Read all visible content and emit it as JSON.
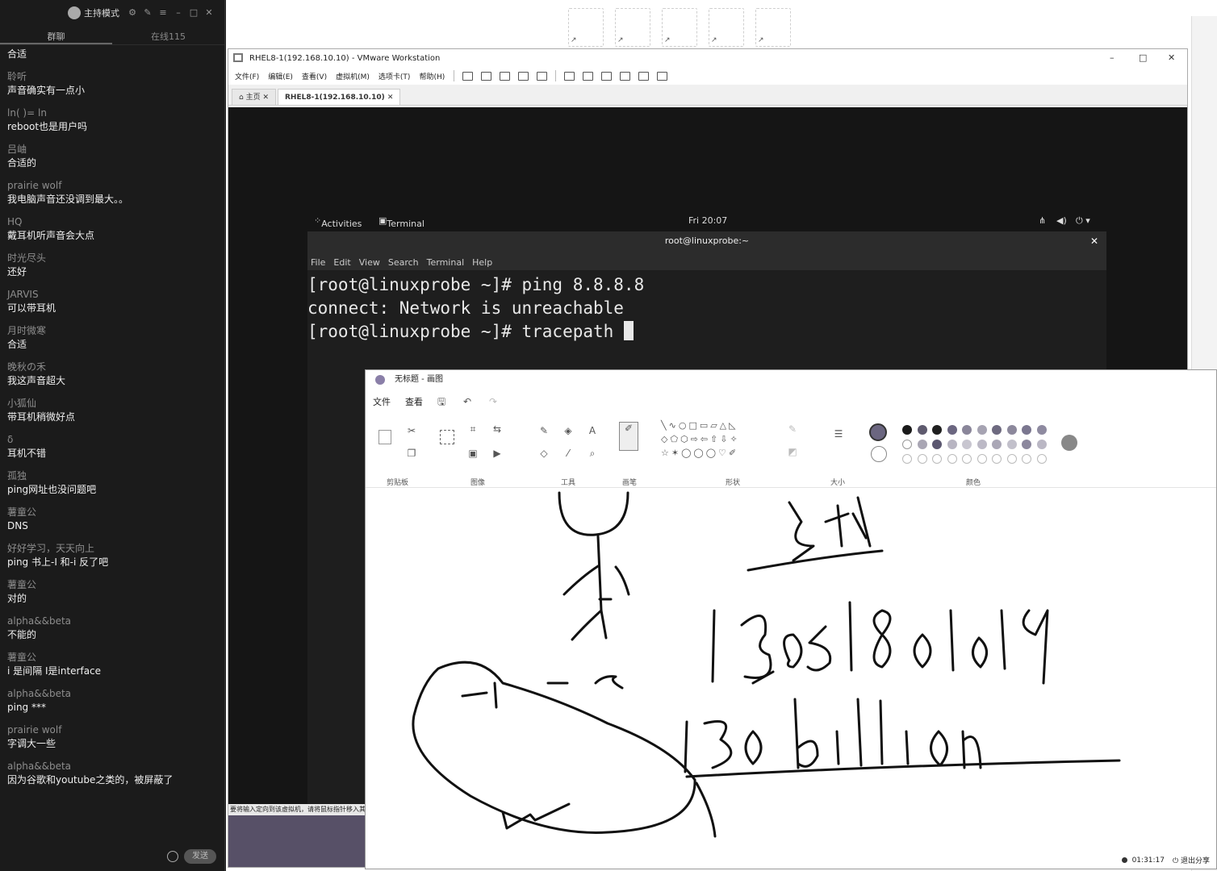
{
  "chat": {
    "mode_label": "主持模式",
    "tabs": [
      "群聊",
      "在线115"
    ],
    "messages": [
      {
        "user": "",
        "text": "合适"
      },
      {
        "user": "聆听",
        "text": "声音确实有一点小"
      },
      {
        "user": "ln(    )=     ln",
        "text": "reboot也是用户吗"
      },
      {
        "user": "吕岫",
        "text": "合适的"
      },
      {
        "user": "prairie wolf",
        "text": "我电脑声音还没调到最大。。"
      },
      {
        "user": "HQ",
        "text": "戴耳机听声音会大点"
      },
      {
        "user": "时光尽头",
        "text": "还好"
      },
      {
        "user": "JARVIS",
        "text": "可以带耳机"
      },
      {
        "user": "月时微寒",
        "text": "合适"
      },
      {
        "user": "晚秋の禾",
        "text": "我这声音超大"
      },
      {
        "user": "小狐仙",
        "text": "带耳机稍微好点"
      },
      {
        "user": "δ",
        "text": "耳机不错"
      },
      {
        "user": "孤独",
        "text": "ping网址也没问题吧"
      },
      {
        "user": "薯童公",
        "text": "DNS"
      },
      {
        "user": "好好学习，天天向上",
        "text": "ping 书上-I  和-i 反了吧"
      },
      {
        "user": "薯童公",
        "text": "对的"
      },
      {
        "user": "alpha&&beta",
        "text": "不能的"
      },
      {
        "user": "薯童公",
        "text": "i 是间隔 I是interface"
      },
      {
        "user": "alpha&&beta",
        "text": "ping  ***"
      },
      {
        "user": "prairie wolf",
        "text": "字调大一些"
      },
      {
        "user": "alpha&&beta",
        "text": "因为谷歌和youtube之类的，被屏蔽了"
      }
    ],
    "send_label": "发送"
  },
  "vmware": {
    "title": "RHEL8-1(192.168.10.10) - VMware Workstation",
    "menu": [
      "文件(F)",
      "编辑(E)",
      "查看(V)",
      "虚拟机(M)",
      "选项卡(T)",
      "帮助(H)"
    ],
    "tabs": [
      "主页",
      "RHEL8-1(192.168.10.10)"
    ],
    "status_text": "要将输入定向到该虚拟机，请将鼠标指针移入其中或按 Ctrl+G。"
  },
  "gnome": {
    "activities": "Activities",
    "app_menu": "Terminal ▾",
    "clock": "Fri 20:07"
  },
  "terminal": {
    "title": "root@linuxprobe:~",
    "menu": [
      "File",
      "Edit",
      "View",
      "Search",
      "Terminal",
      "Help"
    ],
    "lines": [
      "[root@linuxprobe ~]# ping 8.8.8.8",
      "connect: Network is unreachable",
      "[root@linuxprobe ~]# tracepath "
    ]
  },
  "paint": {
    "title": "无标题 - 画图",
    "menu": [
      "文件",
      "查看"
    ],
    "groups": [
      "剪贴板",
      "图像",
      "工具",
      "画笔",
      "形状",
      "大小",
      "颜色"
    ],
    "palette_row1": [
      "#1a1a1a",
      "#5e5a6e",
      "#1f1f1f",
      "#6b6680",
      "#8a869a",
      "#a6a3b2",
      "#6e6a80",
      "#8c889c",
      "#7b7790",
      "#8e8aa0"
    ],
    "palette_row2": [
      "#ffffff",
      "#a9a6b4",
      "#5b5770",
      "#b8b5c2",
      "#c8c6d0",
      "#bcb9c6",
      "#aaa7b6",
      "#c2c0cb",
      "#8b879d",
      "#bab7c4"
    ],
    "canvas_text": [
      "5块",
      "13051801019",
      "130billion"
    ],
    "timer": "01:31:17",
    "exit_label": "退出分享"
  }
}
